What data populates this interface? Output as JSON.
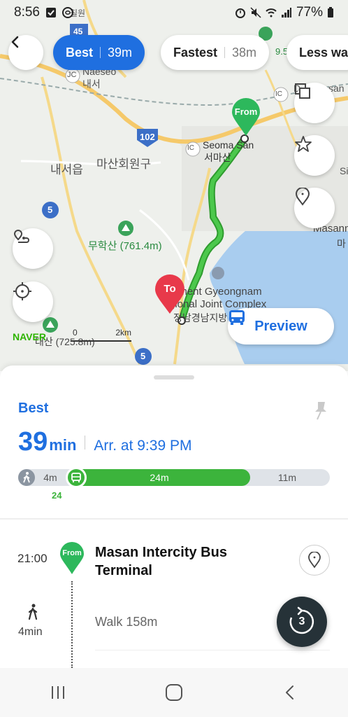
{
  "status_bar": {
    "time": "8:56",
    "battery": "77%"
  },
  "map": {
    "labels": {
      "naeseo_en": "Naeseo",
      "naeseo_kr": "내서",
      "ic1": "IC",
      "jc": "JC",
      "route45": "45",
      "route102": "102",
      "route5a": "5",
      "route5b": "5",
      "naeseoeup": "내서읍",
      "masanhoewon": "마산회원구",
      "seoma_en": "Seoma San",
      "seoma_kr": "서마산",
      "ic2": "IC",
      "ic3": "IC",
      "muhaksan": "무학산 (761.4m)",
      "gyeongnam1": "rnment Gyeongnam",
      "gyeongnam2": "gional Joint Complex",
      "gyeongnam_kr": "정남경남지방 합",
      "masan_right": "Masann",
      "masan_kr_right": "마",
      "peak_left": "대산 (725.8m)",
      "right_d": "D",
      "right_san": "san",
      "right_s": "Si",
      "top_kr": "칠원",
      "top_94": "9.5"
    },
    "from_label": "From",
    "to_label": "To",
    "naver_logo": "NAVER",
    "scale_zero": "0",
    "scale_km": "2km"
  },
  "routes": [
    {
      "label": "Best",
      "duration": "39m",
      "active": true
    },
    {
      "label": "Fastest",
      "duration": "38m",
      "active": false
    },
    {
      "label": "Less wa",
      "duration": "",
      "active": false
    }
  ],
  "preview_label": "Preview",
  "sheet": {
    "route_type": "Best",
    "duration_num": "39",
    "duration_unit": "min",
    "arrival": "Arr. at 9:39 PM",
    "segments": {
      "walk1": "4m",
      "bus": "24m",
      "walk2": "11m"
    },
    "bus_number": "24",
    "departure_time": "21:00",
    "from_marker": "From",
    "stop_name": "Masan Intercity Bus Terminal",
    "walk_minutes": "4min",
    "walk_text": "Walk 158m",
    "refresh_count": "3"
  },
  "colors": {
    "accent": "#1f6fe0",
    "route_green": "#3cb43c",
    "to_red": "#e8394a"
  }
}
